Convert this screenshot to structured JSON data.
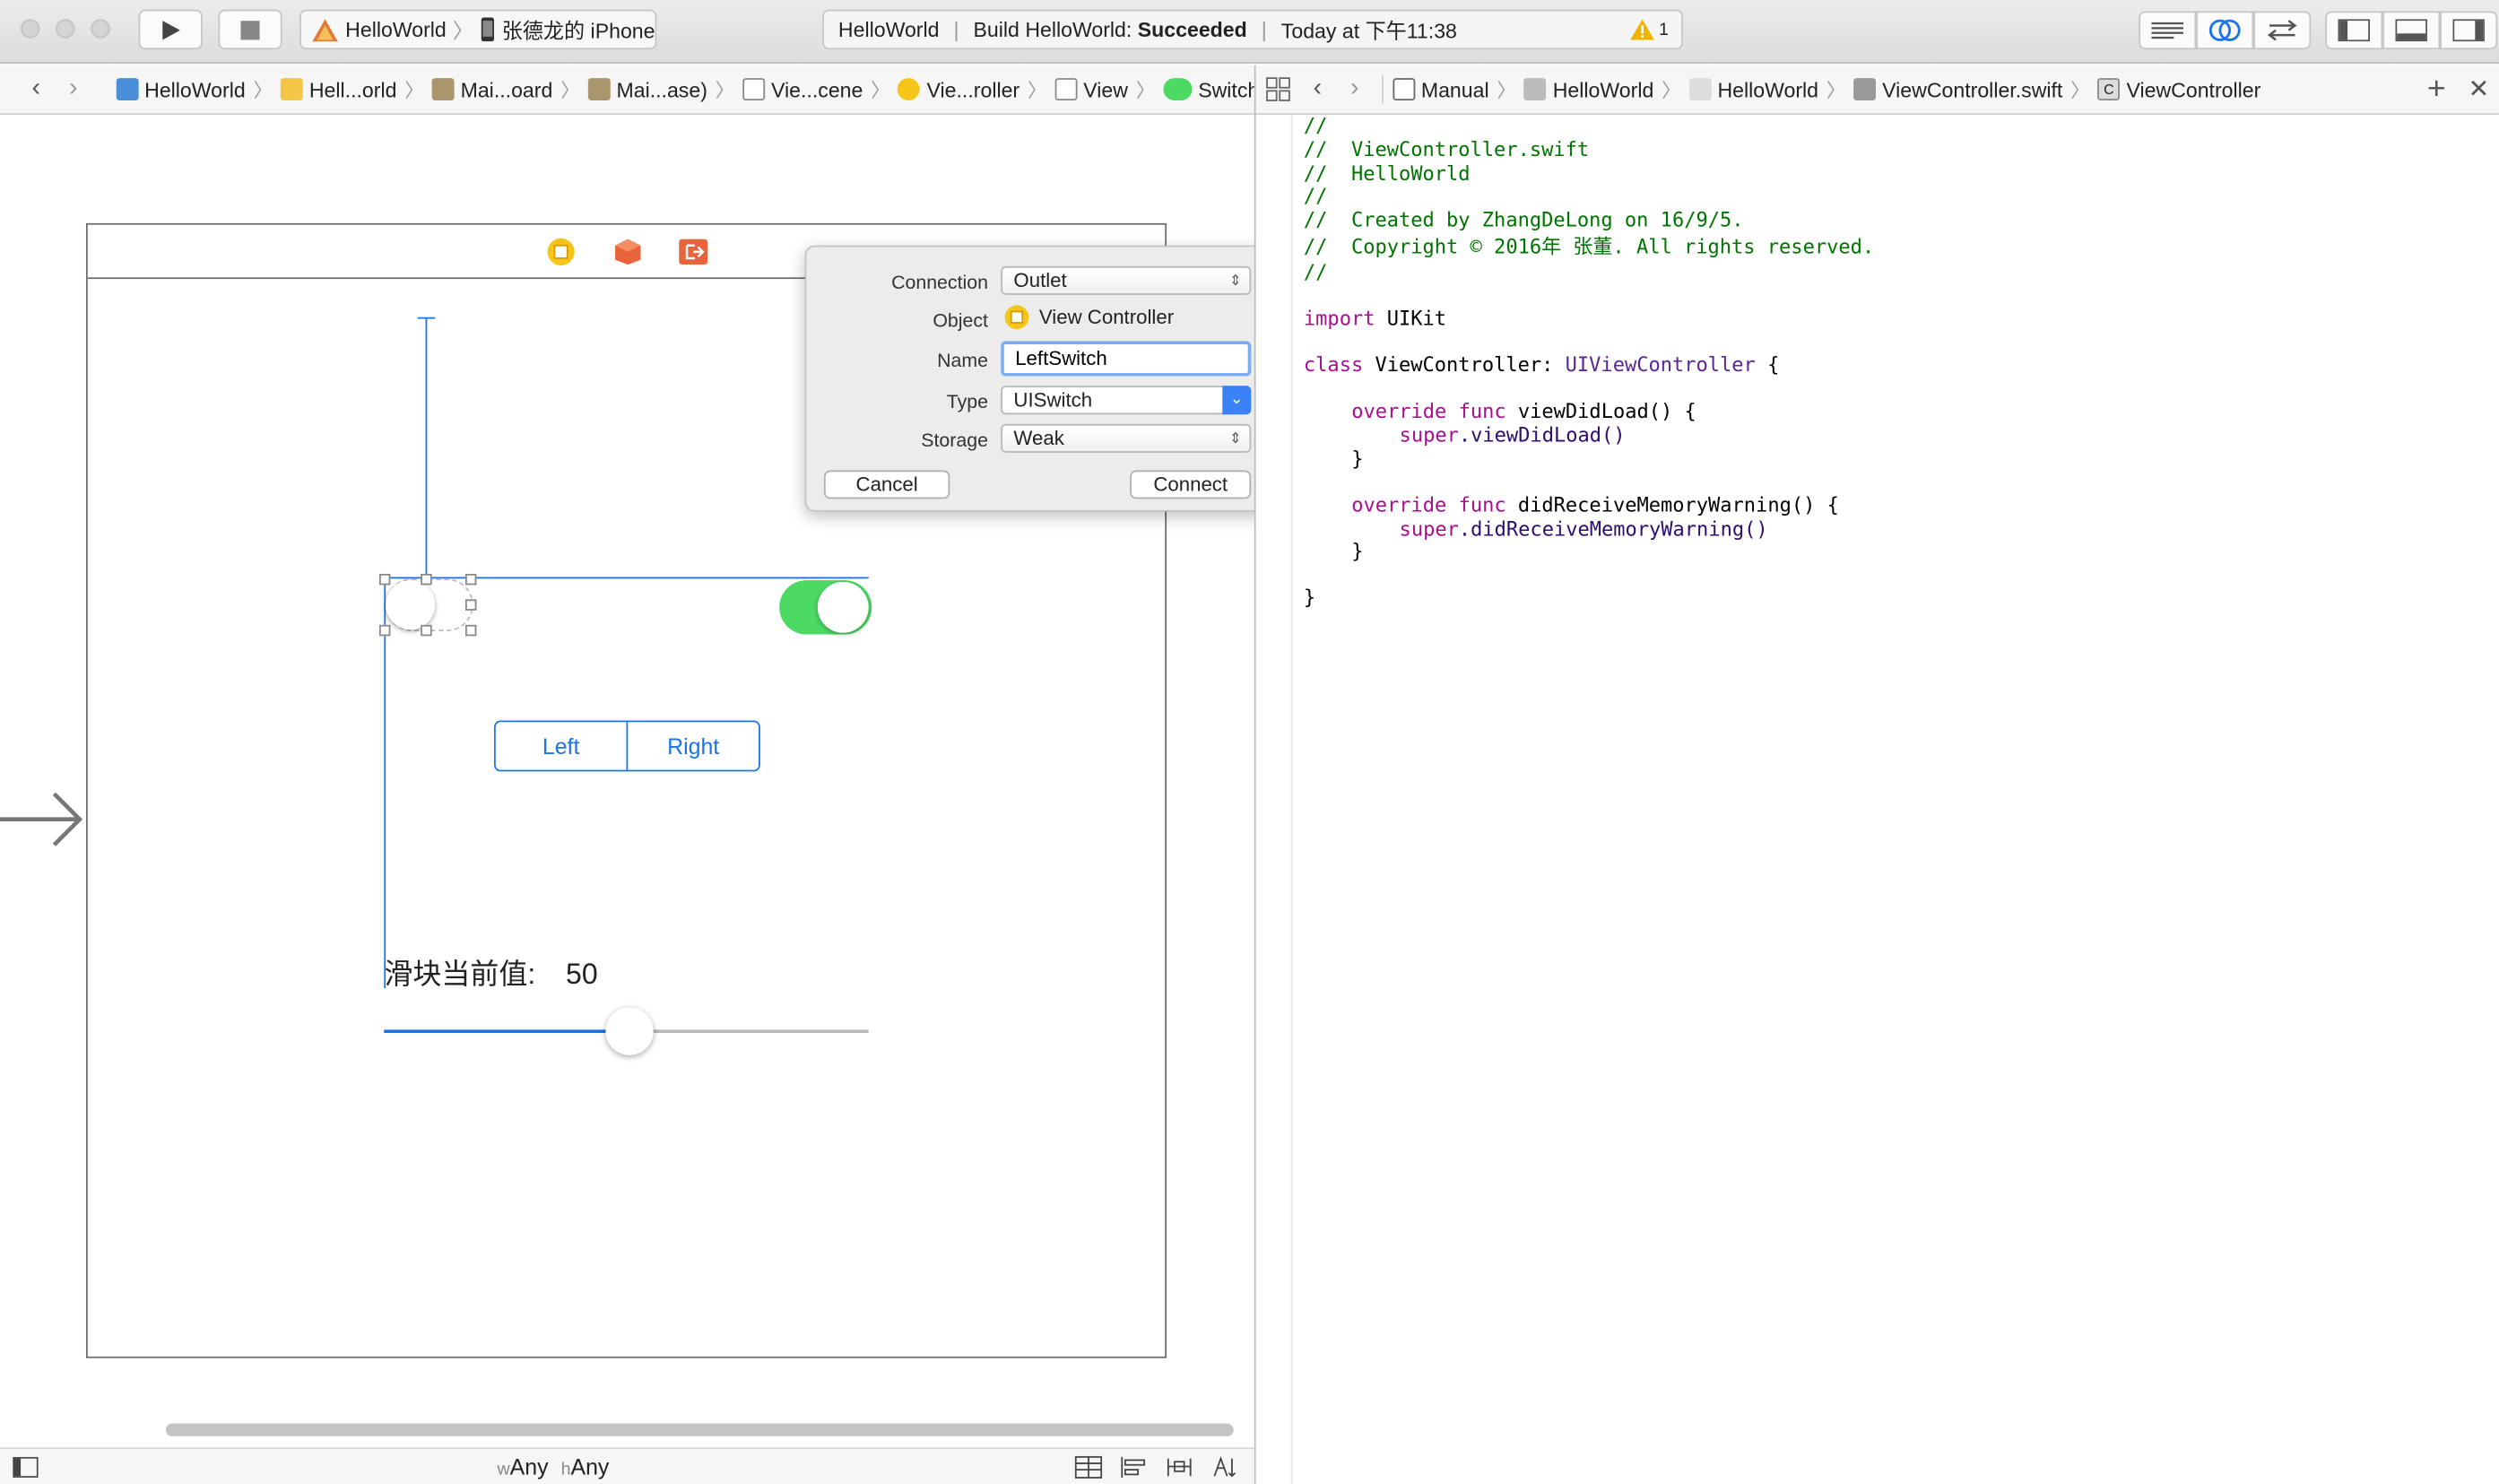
{
  "toolbar": {
    "scheme_target": "HelloWorld",
    "scheme_device": "张德龙的 iPhone",
    "activity_project": "HelloWorld",
    "activity_build_prefix": "Build HelloWorld:",
    "activity_build_status": "Succeeded",
    "activity_time": "Today at 下午11:38",
    "warning_count": "1"
  },
  "left_jumpbar": {
    "items": [
      "HelloWorld",
      "Hell...orld",
      "Mai...oard",
      "Mai...ase)",
      "Vie...cene",
      "Vie...roller",
      "View",
      "Switch"
    ]
  },
  "right_jumpbar": {
    "items": [
      "Manual",
      "HelloWorld",
      "HelloWorld",
      "ViewController.swift",
      "ViewController"
    ]
  },
  "scene": {
    "segment_left": "Left",
    "segment_right": "Right",
    "slider_label": "滑块当前值:",
    "slider_value": "50",
    "slider_fraction": 0.5,
    "right_switch_on": true
  },
  "popover": {
    "connection_label": "Connection",
    "connection_value": "Outlet",
    "object_label": "Object",
    "object_value": "View Controller",
    "name_label": "Name",
    "name_value": "LeftSwitch",
    "type_label": "Type",
    "type_value": "UISwitch",
    "storage_label": "Storage",
    "storage_value": "Weak",
    "cancel_label": "Cancel",
    "connect_label": "Connect"
  },
  "code": {
    "l1": "//",
    "l2": "//  ViewController.swift",
    "l3": "//  HelloWorld",
    "l4": "//",
    "l5": "//  Created by ZhangDeLong on 16/9/5.",
    "l6": "//  Copyright © 2016年 张董. All rights reserved.",
    "l7": "//",
    "import_kw": "import",
    "import_mod": " UIKit",
    "class_kw": "class",
    "class_name": " ViewController: ",
    "class_super": "UIViewController",
    "class_open": " {",
    "override1": "override func",
    "func1": " viewDidLoad() {",
    "super1_kw": "super",
    "super1_call": ".viewDidLoad()",
    "close1": "}",
    "override2": "override func",
    "func2": " didReceiveMemoryWarning() {",
    "super2_kw": "super",
    "super2_call": ".didReceiveMemoryWarning()",
    "close2": "}",
    "close_class": "}"
  },
  "bottom": {
    "w_label": "w",
    "w_value": "Any",
    "h_label": "h",
    "h_value": "Any"
  },
  "colors": {
    "accent": "#1a73e8",
    "switch_on": "#4cd964",
    "comment": "#007400",
    "keyword": "#aa0d91"
  }
}
